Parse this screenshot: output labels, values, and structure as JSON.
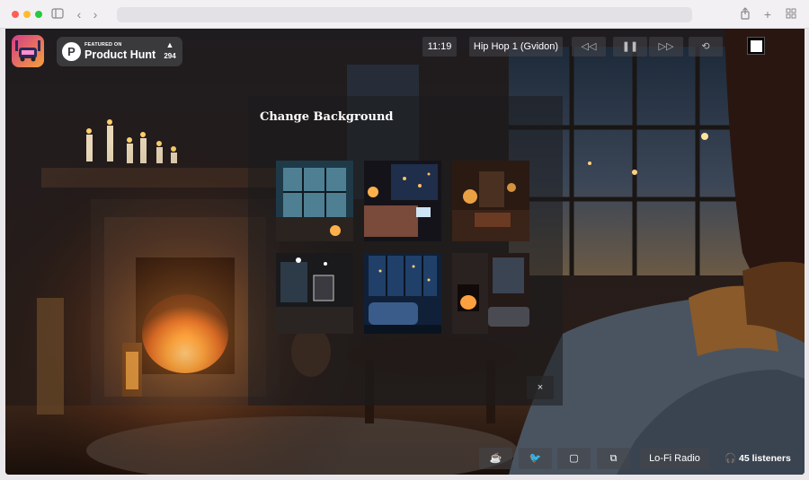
{
  "browser": {
    "sidebar_icon": "sidebar-toggle-icon",
    "back_icon": "chevron-left-icon",
    "forward_icon": "chevron-right-icon",
    "share_icon": "share-icon",
    "new_tab_icon": "plus-icon",
    "tabs_icon": "tab-grid-icon"
  },
  "badge": {
    "featured_label": "FEATURED ON",
    "name": "Product Hunt",
    "upvotes": "294"
  },
  "player": {
    "time": "11:19",
    "track": "Hip Hop 1 (Gvidon)"
  },
  "modal": {
    "title": "Change Background",
    "close_label": "×",
    "thumbnails": [
      "glass-conservatory-room",
      "city-bedroom-night",
      "cozy-library-room",
      "modern-dark-room",
      "blue-city-living-room",
      "fireplace-living-room"
    ]
  },
  "footer": {
    "radio_label": "Lo-Fi Radio",
    "listeners": "45 listeners"
  },
  "colors": {
    "accent_fire": "#ff8a2a",
    "panel": "#1c1c1e",
    "ph_badge_bg": "#3a3a3c"
  }
}
